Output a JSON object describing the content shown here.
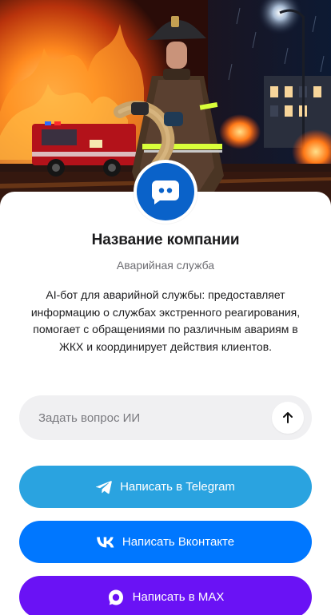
{
  "profile": {
    "name": "Название компании",
    "type": "Аварийная служба",
    "description": "AI-бот для аварийной службы: предоставляет информацию о службах экстренного реагирования, помогает с обращениями по различным авариям в ЖКХ и координирует действия клиентов.",
    "avatar_icon": "chat-bot-icon",
    "avatar_color": "#0a62c9"
  },
  "hero": {
    "image": "firefighter-with-hose-and-fire-truck-illustration"
  },
  "ask": {
    "placeholder": "Задать вопрос ИИ",
    "value": "",
    "send_icon": "arrow-up-icon"
  },
  "actions": [
    {
      "label": "Написать в Telegram",
      "icon": "telegram-icon",
      "color": "#2aa3e0"
    },
    {
      "label": "Написать Вконтакте",
      "icon": "vk-icon",
      "color": "#0077ff"
    },
    {
      "label": "Написать в MAX",
      "icon": "max-icon",
      "color": "#6a12f5"
    }
  ]
}
